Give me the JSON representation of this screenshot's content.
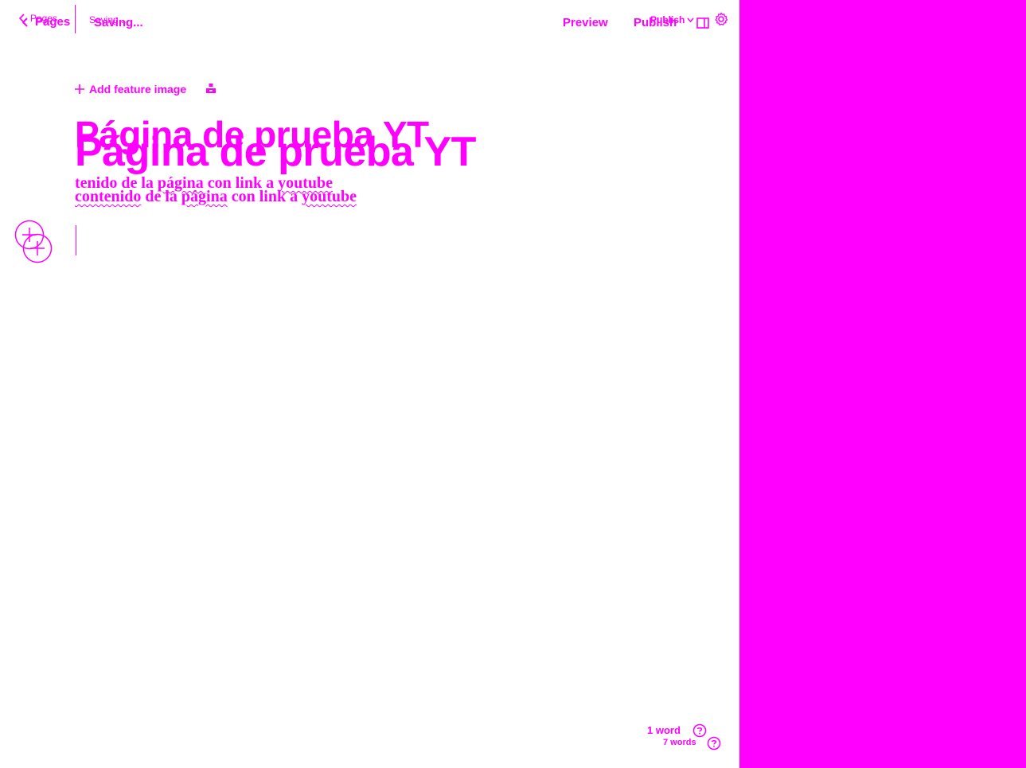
{
  "header": {
    "back_small": "Pages",
    "back_large": "Pages",
    "status_small": "Saving...",
    "status_large": "Saving...",
    "preview": "Preview",
    "publish_large": "Publish",
    "publish_small": "Publish"
  },
  "editor": {
    "add_feature_image": "Add feature image",
    "title_a": "Página de prueba YT",
    "title_b": "Página de prueba YT",
    "body_a": [
      "tenido",
      "de la",
      "página",
      "con link a",
      "youtube"
    ],
    "body_b": [
      "contenido",
      "de la",
      "página",
      "con link a",
      "youtube"
    ]
  },
  "footer": {
    "word_count_a": "1 word",
    "word_count_b": "7 words"
  },
  "colors": {
    "accent": "#ff00ff",
    "background": "#ffffff"
  },
  "icons": [
    "chevron-left-icon",
    "chevron-down-icon",
    "side-panel-icon",
    "gear-icon",
    "plus-icon",
    "image-icon",
    "plus-circle-icon",
    "help-icon"
  ]
}
